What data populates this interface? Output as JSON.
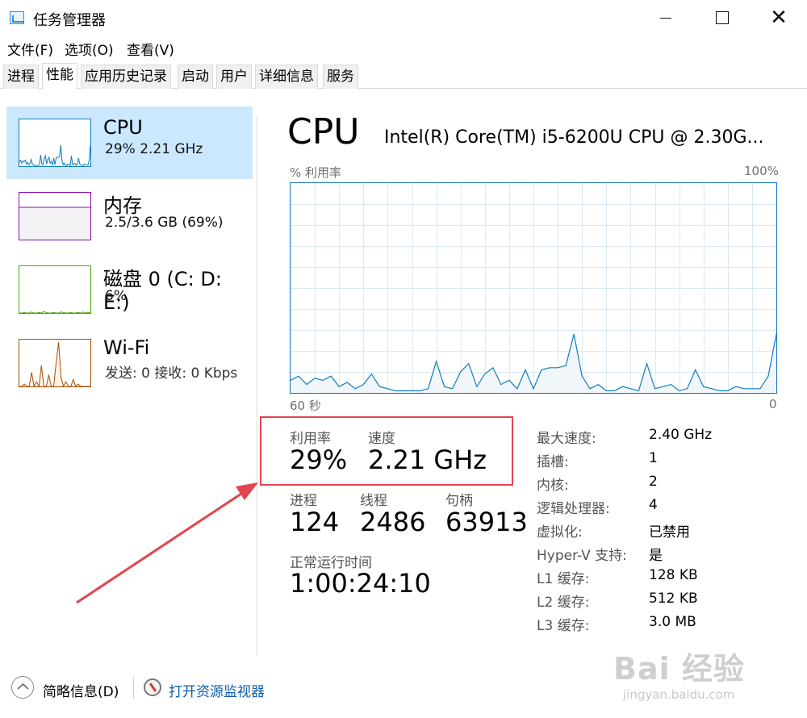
{
  "window": {
    "title": "任务管理器",
    "icons": {
      "app": "task-manager-icon",
      "minimize": "minimize-icon",
      "maximize": "maximize-icon",
      "close": "close-icon"
    },
    "close_glyph": "✕"
  },
  "menu": [
    "文件(F)",
    "选项(O)",
    "查看(V)"
  ],
  "tabs": [
    "进程",
    "性能",
    "应用历史记录",
    "启动",
    "用户",
    "详细信息",
    "服务"
  ],
  "active_tab": "性能",
  "sidebar": {
    "items": [
      {
        "title": "CPU",
        "sub": "29%  2.21 GHz",
        "color": "#117dbb",
        "fill": "#f1f6fa",
        "selected": true
      },
      {
        "title": "内存",
        "sub": "2.5/3.6 GB (69%)",
        "color": "#8b12ae",
        "fill": "#f4f2f4"
      },
      {
        "title": "磁盘 0 (C: D: E:)",
        "sub": "6%",
        "color": "#4da60c",
        "fill": "#ffffff"
      },
      {
        "title": "Wi-Fi",
        "sub": "发送: 0 接收: 0 Kbps",
        "color": "#a74f01",
        "fill": "#fcf3eb"
      }
    ]
  },
  "main": {
    "heading": "CPU",
    "model": "Intel(R) Core(TM) i5-6200U CPU @ 2.30G...",
    "graph_ylabel": "% 利用率",
    "graph_ymax": "100%",
    "graph_xleft": "60 秒",
    "graph_xright": "0",
    "graph_color": "#117dbb",
    "graph_fill": "#f1f6fa",
    "stats": {
      "util_label": "利用率",
      "util_value": "29%",
      "speed_label": "速度",
      "speed_value": "2.21 GHz",
      "proc_label": "进程",
      "proc_value": "124",
      "thread_label": "线程",
      "thread_value": "2486",
      "handle_label": "句柄",
      "handle_value": "63913",
      "uptime_label": "正常运行时间",
      "uptime_value": "1:00:24:10"
    },
    "info": [
      {
        "label": "最大速度:",
        "value": "2.40 GHz"
      },
      {
        "label": "插槽:",
        "value": "1"
      },
      {
        "label": "内核:",
        "value": "2"
      },
      {
        "label": "逻辑处理器:",
        "value": "4"
      },
      {
        "label": "虚拟化:",
        "value": "已禁用"
      },
      {
        "label": "Hyper-V 支持:",
        "value": "是"
      },
      {
        "label": "L1 缓存:",
        "value": "128 KB"
      },
      {
        "label": "L2 缓存:",
        "value": "512 KB"
      },
      {
        "label": "L3 缓存:",
        "value": "3.0 MB"
      }
    ]
  },
  "footer": {
    "summary": "简略信息(D)",
    "resmon": "打开资源监视器",
    "icons": {
      "chevron": "chevron-up-icon",
      "resmon": "resource-monitor-icon"
    }
  },
  "watermark": {
    "big": "Bai 经验",
    "small": "jingyan.baidu.com"
  },
  "annotation": {
    "highlight_color": "#e4444e"
  },
  "chart_data": {
    "type": "area",
    "title": "",
    "xlabel": "",
    "ylabel": "% 利用率",
    "ylim": [
      0,
      100
    ],
    "x": [
      60,
      59,
      58,
      57,
      56,
      55,
      54,
      53,
      52,
      51,
      50,
      49,
      48,
      47,
      46,
      45,
      44,
      43,
      42,
      41,
      40,
      39,
      38,
      37,
      36,
      35,
      34,
      33,
      32,
      31,
      30,
      29,
      28,
      27,
      26,
      25,
      24,
      23,
      22,
      21,
      20,
      19,
      18,
      17,
      16,
      15,
      14,
      13,
      12,
      11,
      10,
      9,
      8,
      7,
      6,
      5,
      4,
      3,
      2,
      1,
      0
    ],
    "series": [
      {
        "values": [
          6,
          8,
          4,
          7,
          6,
          8,
          3,
          5,
          2,
          4,
          9,
          3,
          2,
          1,
          1,
          1,
          1,
          2,
          15,
          3,
          2,
          10,
          14,
          3,
          9,
          12,
          4,
          6,
          2,
          11,
          2,
          11,
          12,
          12,
          13,
          28,
          8,
          2,
          4,
          1,
          1,
          3,
          2,
          1,
          14,
          2,
          3,
          4,
          1,
          2,
          11,
          3,
          2,
          1,
          1,
          3,
          2,
          2,
          2,
          8,
          28
        ]
      }
    ]
  }
}
